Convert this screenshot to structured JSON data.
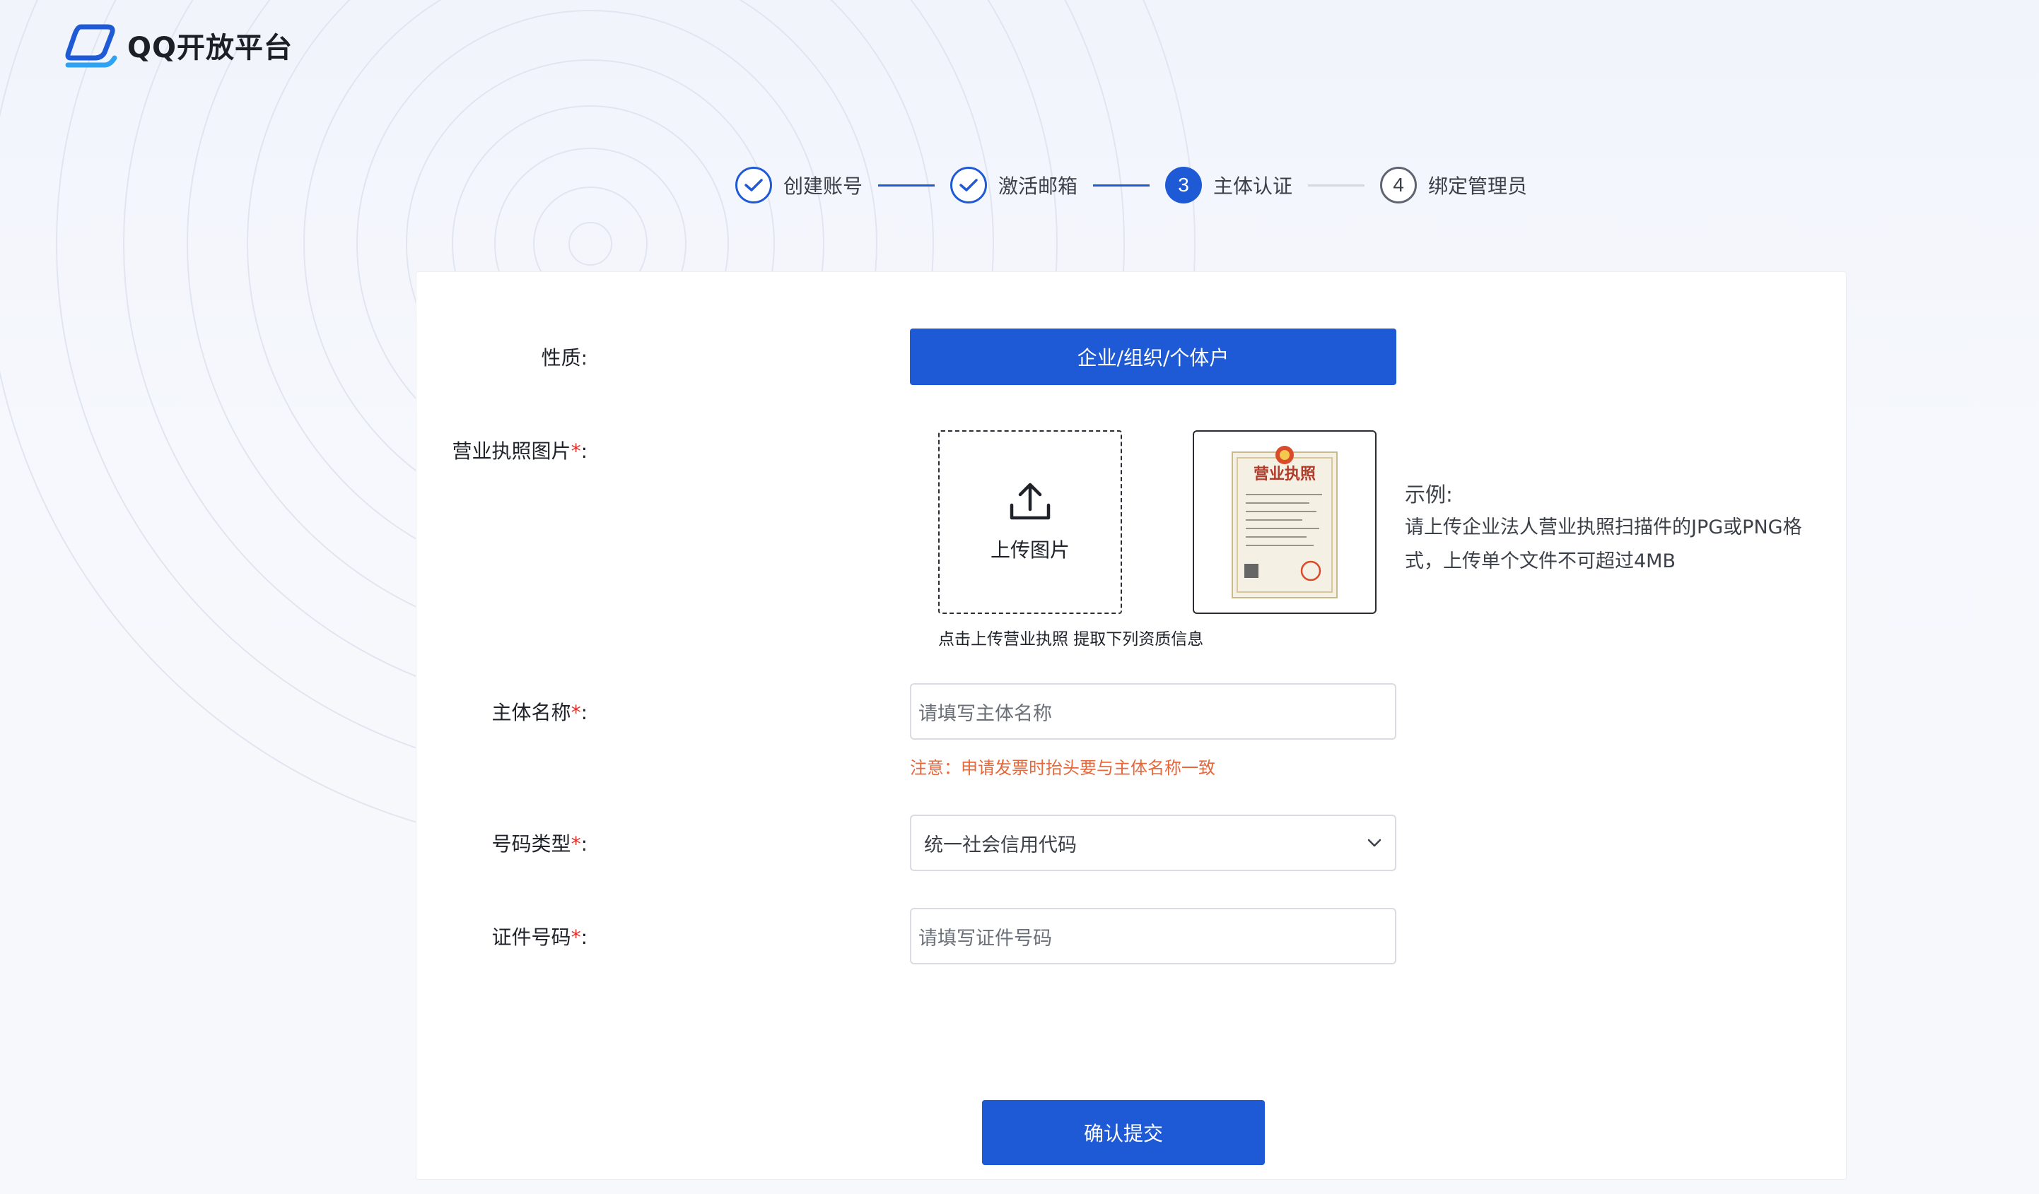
{
  "header": {
    "logo_text": "QQ开放平台",
    "logo_icon": "qq-open-platform-logo"
  },
  "steps": [
    {
      "index": "1",
      "label": "创建账号",
      "state": "done"
    },
    {
      "index": "2",
      "label": "激活邮箱",
      "state": "done"
    },
    {
      "index": "3",
      "label": "主体认证",
      "state": "active"
    },
    {
      "index": "4",
      "label": "绑定管理员",
      "state": "todo"
    }
  ],
  "form": {
    "type_label": "性质:",
    "type_button": "企业/组织/个体户",
    "license_label": "营业执照图片",
    "required_mark": "*",
    "colon": ":",
    "upload_text": "上传图片",
    "upload_hint": "点击上传营业执照 提取下列资质信息",
    "example_title": "示例:",
    "example_desc": "请上传企业法人营业执照扫描件的JPG或PNG格式，上传单个文件不可超过4MB",
    "license_image_title": "营业执照",
    "name_label": "主体名称",
    "name_placeholder": "请填写主体名称",
    "name_notice": "注意：申请发票时抬头要与主体名称一致",
    "idtype_label": "号码类型",
    "idtype_value": "统一社会信用代码",
    "idnum_label": "证件号码",
    "idnum_placeholder": "请填写证件号码",
    "submit": "确认提交"
  },
  "colors": {
    "primary": "#1f5ad6",
    "required": "#e0312c",
    "notice": "#e8673a"
  }
}
